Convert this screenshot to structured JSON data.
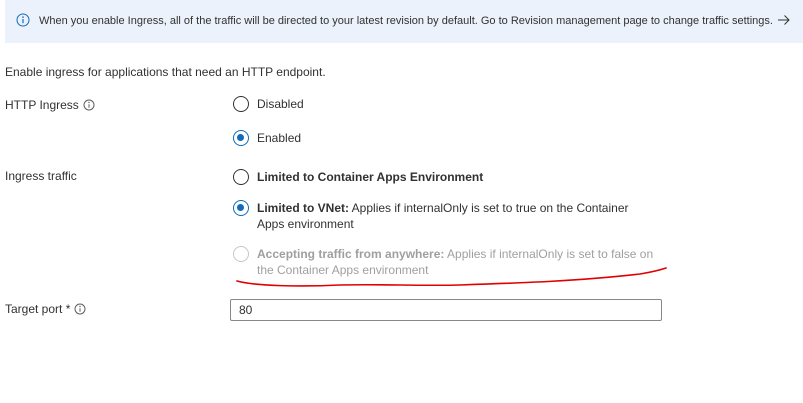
{
  "banner": {
    "text": "When you enable Ingress, all of the traffic will be directed to your latest revision by default. Go to Revision management page to change traffic settings.",
    "icon": "info-icon",
    "link_icon": "arrow-right-icon"
  },
  "intro": "Enable ingress for applications that need an HTTP endpoint.",
  "http_ingress": {
    "label": "HTTP Ingress",
    "options": [
      {
        "label": "Disabled",
        "checked": false
      },
      {
        "label": "Enabled",
        "checked": true
      }
    ]
  },
  "ingress_traffic": {
    "label": "Ingress traffic",
    "options": [
      {
        "title": "Limited to Container Apps Environment",
        "desc": "",
        "checked": false,
        "disabled": false
      },
      {
        "title": "Limited to VNet:",
        "desc": " Applies if internalOnly is set to true on the Container Apps environment",
        "checked": true,
        "disabled": false
      },
      {
        "title": "Accepting traffic from anywhere:",
        "desc": " Applies if internalOnly is set to false on the Container Apps environment",
        "checked": false,
        "disabled": true
      }
    ]
  },
  "target_port": {
    "label": "Target port *",
    "value": "80"
  },
  "colors": {
    "banner_bg": "#ecf2fb",
    "accent": "#0f6cbd",
    "annotation": "#e00000"
  }
}
